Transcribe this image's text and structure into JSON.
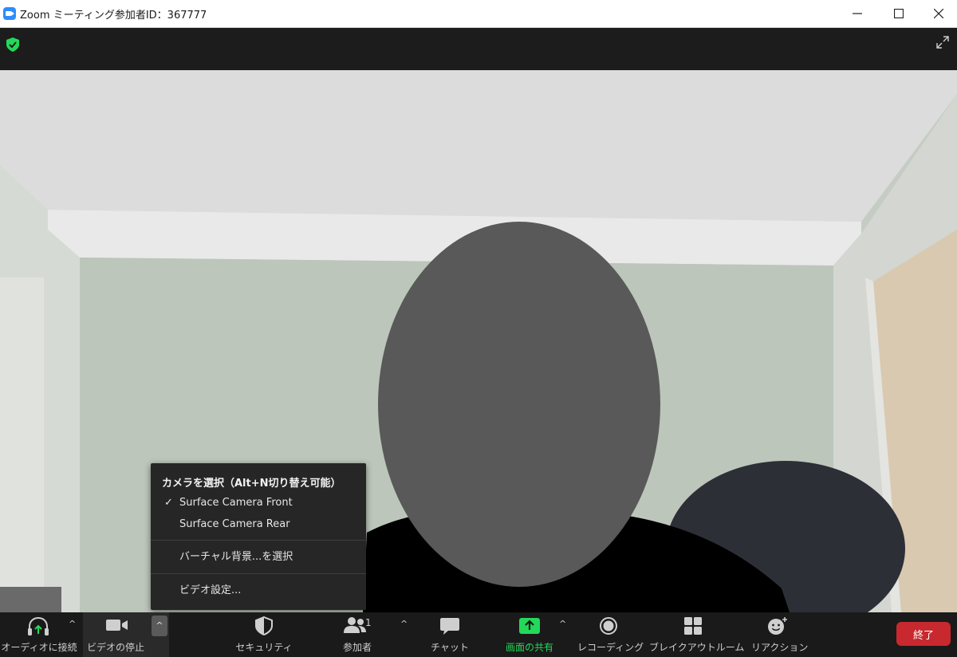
{
  "window": {
    "title": "Zoom ミーティング参加者ID：367777"
  },
  "camera_menu": {
    "title": "カメラを選択（Alt+N切り替え可能）",
    "cameras": [
      {
        "label": "Surface Camera Front",
        "checked": true
      },
      {
        "label": "Surface Camera Rear",
        "checked": false
      }
    ],
    "virtual_background": "バーチャル背景...を選択",
    "video_settings": "ビデオ設定..."
  },
  "toolbar": {
    "audio": "オーディオに接続",
    "video": "ビデオの停止",
    "security": "セキュリティ",
    "participants": "参加者",
    "participants_count": "1",
    "chat": "チャット",
    "share": "画面の共有",
    "recording": "レコーディング",
    "breakout": "ブレイクアウトルーム",
    "reactions": "リアクション",
    "end": "終了"
  },
  "colors": {
    "accent_green": "#23d959",
    "end_red": "#c7292f",
    "toolbar_bg": "#1a1a1a"
  }
}
